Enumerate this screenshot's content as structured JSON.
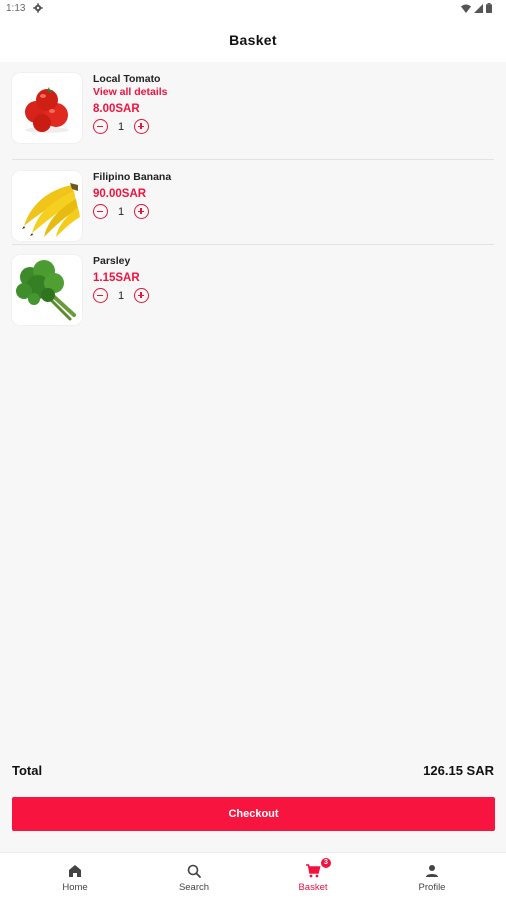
{
  "status_bar": {
    "time": "1:13"
  },
  "header": {
    "title": "Basket"
  },
  "items": [
    {
      "name": "Local Tomato",
      "details_link": "View all details",
      "price": "8.00SAR",
      "quantity": "1",
      "image": "tomato"
    },
    {
      "name": "Filipino Banana",
      "price": "90.00SAR",
      "quantity": "1",
      "image": "banana"
    },
    {
      "name": "Parsley",
      "price": "1.15SAR",
      "quantity": "1",
      "image": "parsley"
    }
  ],
  "total": {
    "label": "Total",
    "value": "126.15 SAR"
  },
  "checkout": {
    "label": "Checkout"
  },
  "nav": {
    "items": [
      {
        "label": "Home",
        "icon": "home-icon"
      },
      {
        "label": "Search",
        "icon": "search-icon"
      },
      {
        "label": "Basket",
        "icon": "cart-icon",
        "badge": "3",
        "active": true
      },
      {
        "label": "Profile",
        "icon": "profile-icon"
      }
    ]
  },
  "colors": {
    "accent": "#f0133f",
    "background": "#f7f7f7"
  }
}
